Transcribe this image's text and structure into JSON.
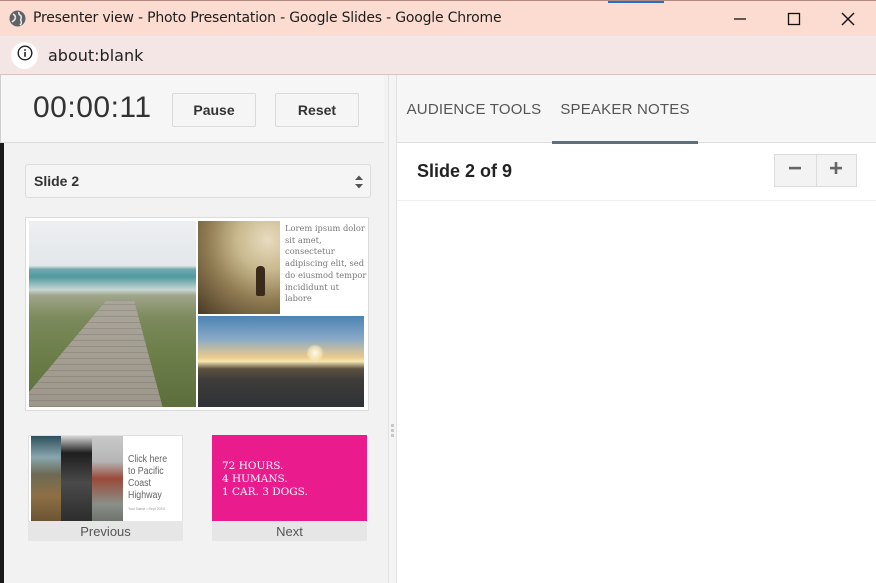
{
  "window": {
    "title": "Presenter view - Photo Presentation - Google Slides - Google Chrome",
    "controls": [
      "minimize",
      "maximize",
      "close"
    ]
  },
  "address_bar": {
    "icon": "info-icon",
    "url": "about:blank"
  },
  "timer": {
    "elapsed": "00:00:11",
    "pause_label": "Pause",
    "reset_label": "Reset"
  },
  "slide_selector": {
    "selected": "Slide 2"
  },
  "current_slide": {
    "body_text": "Lorem ipsum dolor sit amet, consectetur adipiscing elit, sed do eiusmod tempor incididunt ut labore",
    "images": [
      "boardwalk-beach-photo",
      "hiker-mountain-photo",
      "sunset-road-photo"
    ]
  },
  "previous_slide": {
    "title": "Click here to Pacific Coast Highway",
    "subtitle": "Your Name • Sept 20XX",
    "label": "Previous"
  },
  "next_slide": {
    "lines": [
      "72 HOURS.",
      "4 HUMANS.",
      "1 CAR. 3 DOGS."
    ],
    "label": "Next",
    "background_color": "#ea1b8d"
  },
  "tabs": [
    {
      "label": "AUDIENCE TOOLS",
      "active": false
    },
    {
      "label": "SPEAKER NOTES",
      "active": true
    }
  ],
  "notes": {
    "slide_position": "Slide 2 of 9",
    "text": ""
  },
  "colors": {
    "titlebar": "#fcdcd0",
    "addressbar": "#f3e6e5",
    "tab_underline": "#5b707a"
  }
}
